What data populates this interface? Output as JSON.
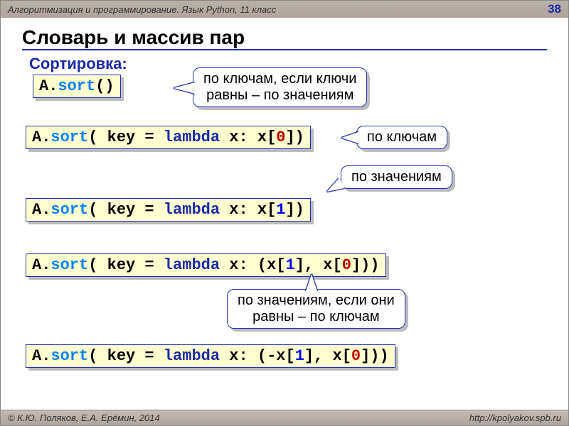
{
  "topbar": {
    "course": "Алгоритмизация и программирование. Язык Python, 11 класс",
    "page": "38"
  },
  "title": "Словарь и массив пар",
  "subtitle": "Сортировка:",
  "code": {
    "c1": {
      "a": "A.",
      "m": "sort",
      "p": "()"
    },
    "c2": {
      "a": "A.",
      "m": "sort",
      "p1": "( key = ",
      "kw": "lambda",
      "p2": " x: x[",
      "n": "0",
      "p3": "])"
    },
    "c3": {
      "a": "A.",
      "m": "sort",
      "p1": "( key = ",
      "kw": "lambda",
      "p2": " x: x[",
      "n": "1",
      "p3": "])"
    },
    "c4": {
      "a": "A.",
      "m": "sort",
      "p1": "( key = ",
      "kw": "lambda",
      "p2": " x: (x[",
      "n1": "1",
      "p3": "], x[",
      "n2": "0",
      "p4": "]))"
    },
    "c5": {
      "a": "A.",
      "m": "sort",
      "p1": "( key = ",
      "kw": "lambda",
      "p2": " x: (-x[",
      "n1": "1",
      "p3": "], x[",
      "n2": "0",
      "p4": "]))"
    }
  },
  "callouts": {
    "cal1_l1": "по ключам, если ключи",
    "cal1_l2": "равны – по значениям",
    "cal2": "по ключам",
    "cal3": "по значениям",
    "cal4_l1": "по значениям, если они",
    "cal4_l2": "равны – по ключам"
  },
  "footer": {
    "authors": "© К.Ю. Поляков, Е.А. Ерёмин, 2014",
    "url": "http://kpolyakov.spb.ru"
  }
}
